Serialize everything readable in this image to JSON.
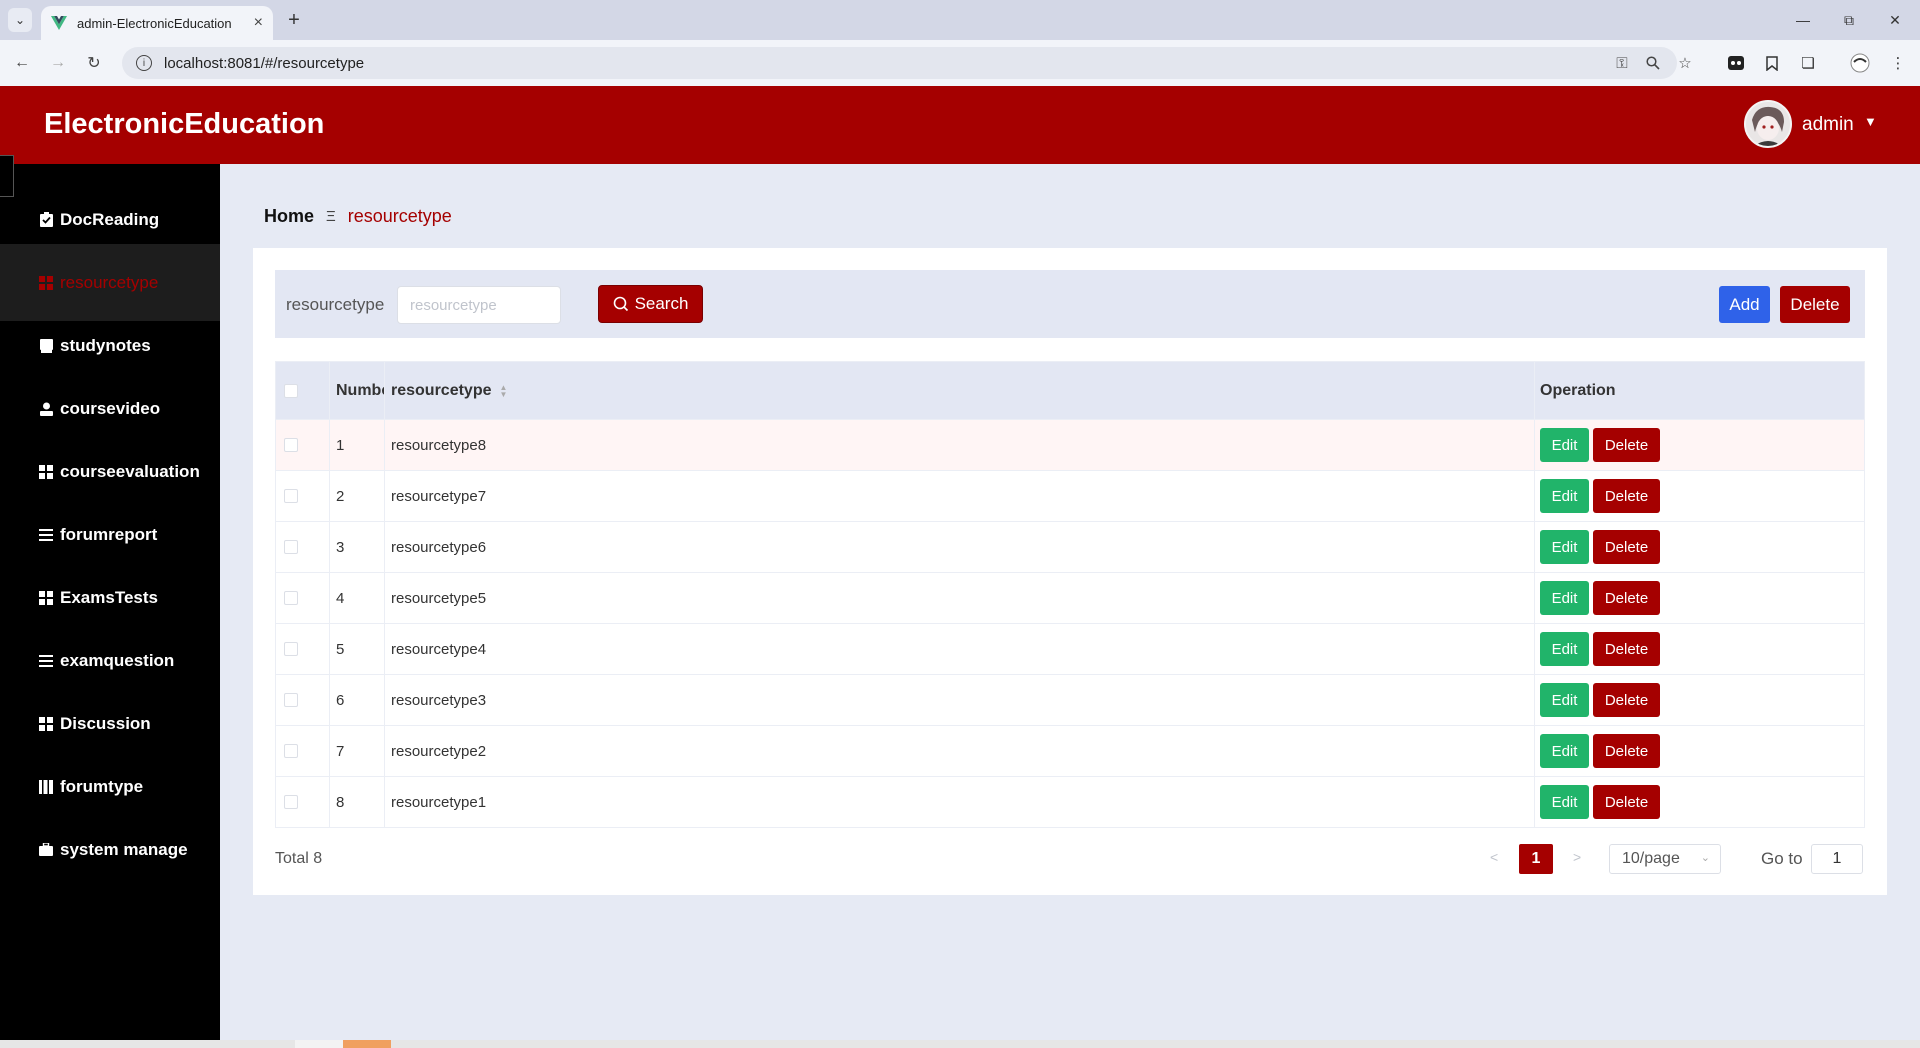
{
  "browser": {
    "tab_title": "admin-ElectronicEducation",
    "url": "localhost:8081/#/resourcetype",
    "colors": {
      "tabbar": "#d3d7e6",
      "toolbar": "#f2f4f9"
    }
  },
  "header": {
    "app_title": "ElectronicEducation",
    "user": "admin",
    "colors": {
      "brand": "#a50000"
    }
  },
  "sidebar": {
    "items": [
      {
        "label": "DocReading",
        "icon": "clipboard-check-icon",
        "active": false
      },
      {
        "label": "resourcetype",
        "icon": "grid-icon",
        "active": true
      },
      {
        "label": "studynotes",
        "icon": "book-icon",
        "active": false
      },
      {
        "label": "coursevideo",
        "icon": "person-icon",
        "active": false
      },
      {
        "label": "courseevaluation",
        "icon": "grid-icon",
        "active": false
      },
      {
        "label": "forumreport",
        "icon": "list-icon",
        "active": false
      },
      {
        "label": "ExamsTests",
        "icon": "grid-icon",
        "active": false
      },
      {
        "label": "examquestion",
        "icon": "list-icon",
        "active": false
      },
      {
        "label": "Discussion",
        "icon": "grid-icon",
        "active": false
      },
      {
        "label": "forumtype",
        "icon": "columns-icon",
        "active": false
      },
      {
        "label": "system manage",
        "icon": "briefcase-icon",
        "active": false
      }
    ]
  },
  "breadcrumb": {
    "home": "Home",
    "separator": "Ξ",
    "current": "resourcetype"
  },
  "filter": {
    "label": "resourcetype",
    "placeholder": "resourcetype",
    "value": "",
    "search_label": "Search",
    "add_label": "Add",
    "delete_label": "Delete"
  },
  "table": {
    "columns": {
      "number": "Number",
      "type": "resourcetype",
      "operation": "Operation"
    },
    "edit_label": "Edit",
    "delete_label": "Delete",
    "rows": [
      {
        "num": "1",
        "type": "resourcetype8"
      },
      {
        "num": "2",
        "type": "resourcetype7"
      },
      {
        "num": "3",
        "type": "resourcetype6"
      },
      {
        "num": "4",
        "type": "resourcetype5"
      },
      {
        "num": "5",
        "type": "resourcetype4"
      },
      {
        "num": "6",
        "type": "resourcetype3"
      },
      {
        "num": "7",
        "type": "resourcetype2"
      },
      {
        "num": "8",
        "type": "resourcetype1"
      }
    ]
  },
  "pagination": {
    "total": "Total 8",
    "current_page": "1",
    "page_size": "10/page",
    "goto_label": "Go to",
    "goto_value": "1"
  }
}
